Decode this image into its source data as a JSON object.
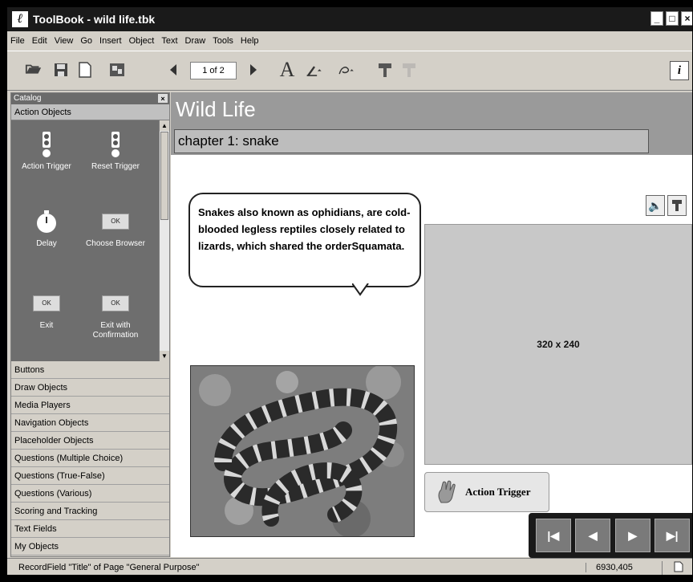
{
  "window": {
    "title": "ToolBook - wild life.tbk",
    "buttons": [
      "_",
      "□",
      "×"
    ]
  },
  "menu": [
    "File",
    "Edit",
    "View",
    "Go",
    "Insert",
    "Object",
    "Text",
    "Draw",
    "Tools",
    "Help"
  ],
  "toolbar": {
    "page_indicator": "1 of 2",
    "info_label": "i"
  },
  "catalog": {
    "title": "Catalog",
    "open_section": "Action Objects",
    "objects": [
      {
        "label": "Action Trigger"
      },
      {
        "label": "Reset Trigger"
      },
      {
        "label": "Delay"
      },
      {
        "label": "Choose Browser"
      },
      {
        "label": "Exit"
      },
      {
        "label": "Exit with Confirmation"
      }
    ],
    "ok_label": "OK",
    "sections": [
      "Buttons",
      "Draw Objects",
      "Media Players",
      "Navigation Objects",
      "Placeholder Objects",
      "Questions (Multiple Choice)",
      "Questions (True-False)",
      "Questions (Various)",
      "Scoring and Tracking",
      "Text Fields",
      "My Objects"
    ]
  },
  "page": {
    "title": "Wild Life",
    "chapter": "chapter 1: snake",
    "bubble_text": "Snakes also known as ophidians, are cold-blooded legless reptiles closely related to lizards, which shared the orderSquamata.",
    "placeholder_label": "320 x 240",
    "action_trigger_label": "Action Trigger",
    "nav_buttons": [
      "|◀",
      "◀",
      "▶",
      "▶|"
    ]
  },
  "statusbar": {
    "text": "RecordField \"Title\" of Page \"General Purpose\"",
    "coords": "6930,405"
  },
  "colors": {
    "header_band": "#9a9a9a",
    "catalog_panel": "#6e6e6e",
    "navbar": "#1a1a1a"
  }
}
